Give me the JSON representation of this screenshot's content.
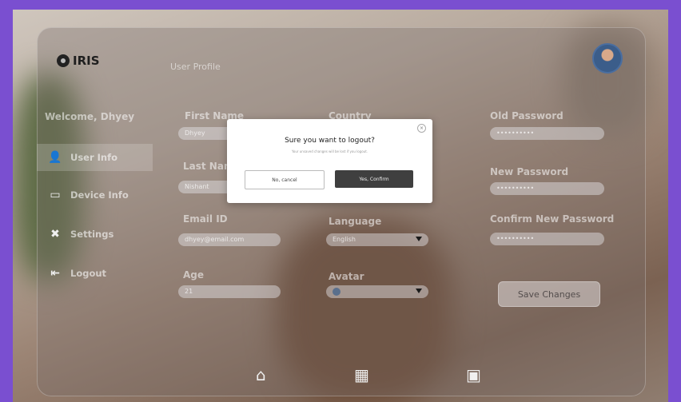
{
  "app": {
    "logo_text": "IRIS",
    "page_title": "User Profile"
  },
  "sidebar": {
    "welcome": "Welcome, Dhyey",
    "items": [
      {
        "label": "User Info",
        "icon": "user-icon",
        "active": true
      },
      {
        "label": "Device Info",
        "icon": "device-icon",
        "active": false
      },
      {
        "label": "Settings",
        "icon": "tools-icon",
        "active": false
      },
      {
        "label": "Logout",
        "icon": "logout-icon",
        "active": false
      }
    ]
  },
  "form": {
    "first_name": {
      "label": "First Name",
      "value": "Dhyey"
    },
    "last_name": {
      "label": "Last Name",
      "value": "Nishant"
    },
    "email": {
      "label": "Email ID",
      "value": "dhyey@email.com"
    },
    "age": {
      "label": "Age",
      "value": "21"
    },
    "country": {
      "label": "Country",
      "value": ""
    },
    "language": {
      "label": "Language",
      "value": "English"
    },
    "avatar": {
      "label": "Avatar",
      "value": ""
    },
    "old_password": {
      "label": "Old Password",
      "value": "••••••••••"
    },
    "new_password": {
      "label": "New Password",
      "value": "••••••••••"
    },
    "confirm_password": {
      "label": "Confirm New Password",
      "value": "••••••••••"
    },
    "save_label": "Save Changes"
  },
  "modal": {
    "title": "Sure you want to logout?",
    "subtitle": "Your unsaved changes will be lost if you logout.",
    "cancel_label": "No, cancel",
    "confirm_label": "Yes, Confirm",
    "close_glyph": "×"
  },
  "bottom_nav": [
    {
      "icon": "home-icon",
      "glyph": "⌂"
    },
    {
      "icon": "grid-icon",
      "glyph": "▦"
    },
    {
      "icon": "gallery-icon",
      "glyph": "▣"
    }
  ],
  "colors": {
    "frame_border": "#7a4fd0",
    "confirm_bg": "#3f3f3f"
  }
}
